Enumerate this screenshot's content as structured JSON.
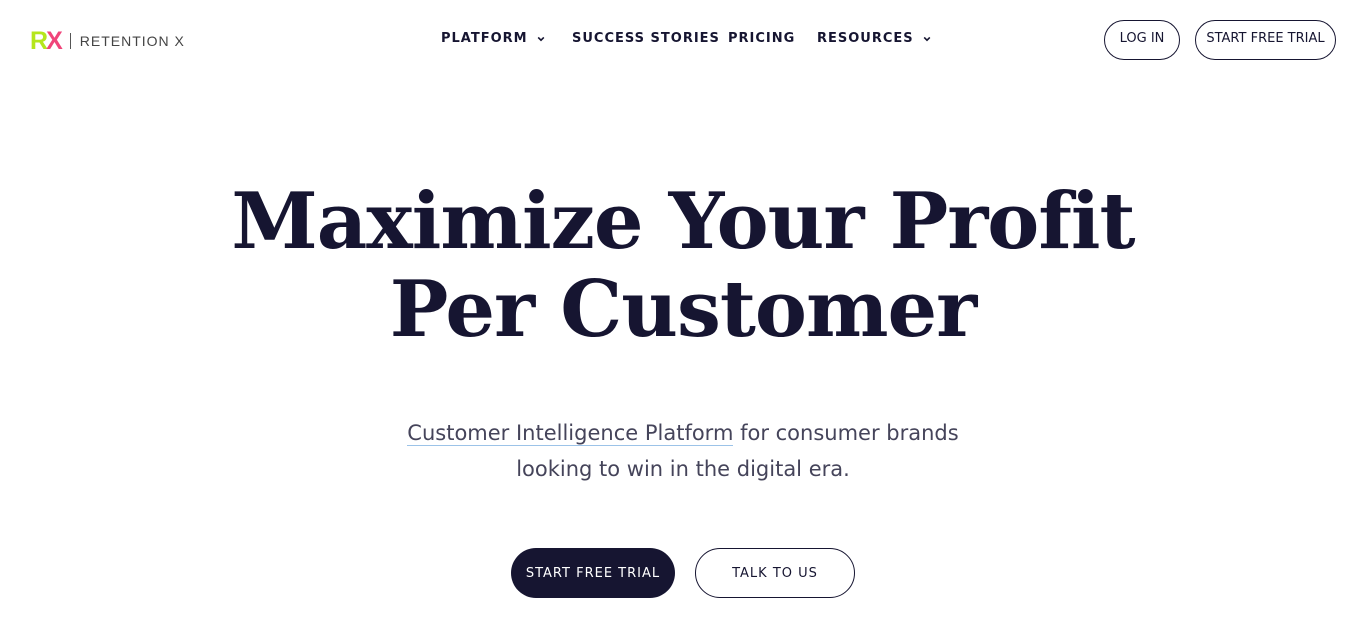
{
  "brand": {
    "mark_r": "R",
    "mark_x": "X",
    "name": "RETENTION X",
    "colors": {
      "r": "#b5e61d",
      "x": "#f0457a",
      "text": "#161531"
    }
  },
  "nav": {
    "items": [
      {
        "label": "PLATFORM",
        "icon": "chevron-down-icon"
      },
      {
        "label": "SUCCESS STORIES"
      },
      {
        "label": "PRICING"
      },
      {
        "label": "RESOURCES",
        "icon": "chevron-down-icon"
      }
    ],
    "login_label": "LOG IN",
    "trial_label": "START FREE TRIAL"
  },
  "hero": {
    "title_line1": "Maximize Your Profit",
    "title_line2": "Per Customer",
    "subtitle_link": "Customer Intelligence Platform",
    "subtitle_rest_1": " for consumer brands",
    "subtitle_line2": "looking to win in the digital era.",
    "primary_cta": "START FREE TRIAL",
    "secondary_cta": "TALK TO US"
  }
}
